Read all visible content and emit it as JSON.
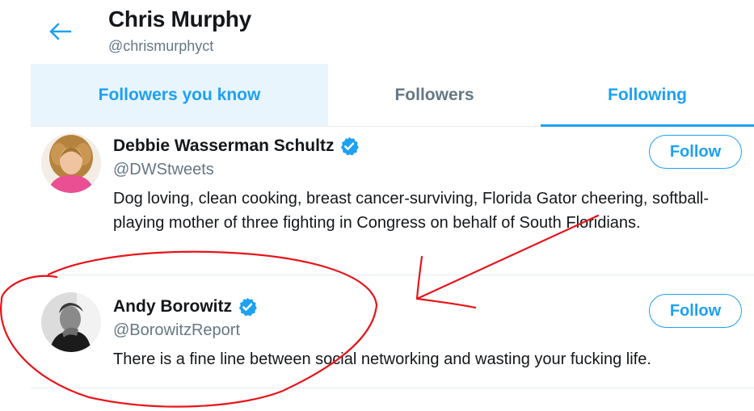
{
  "profile": {
    "name": "Chris Murphy",
    "handle": "@chrismurphyct"
  },
  "tabs": [
    {
      "label": "Followers you know",
      "state": "hover"
    },
    {
      "label": "Followers",
      "state": "inactive"
    },
    {
      "label": "Following",
      "state": "active"
    }
  ],
  "users": [
    {
      "name": "Debbie Wasserman Schultz",
      "handle": "@DWStweets",
      "verified": true,
      "bio": "Dog loving, clean cooking, breast cancer-surviving, Florida Gator cheering, softball-playing mother of three fighting in Congress on behalf of South Floridians.",
      "follow_label": "Follow"
    },
    {
      "name": "Andy Borowitz",
      "handle": "@BorowitzReport",
      "verified": true,
      "bio": "There is a fine line between social networking and wasting your fucking life.",
      "follow_label": "Follow"
    }
  ],
  "icons": {
    "back": "arrow-left-icon",
    "verified": "verified-badge-icon"
  },
  "colors": {
    "accent": "#1da1f2",
    "tab_hover_bg": "#e8f5fd",
    "secondary_text": "#657786",
    "annotation": "#e8141a"
  }
}
